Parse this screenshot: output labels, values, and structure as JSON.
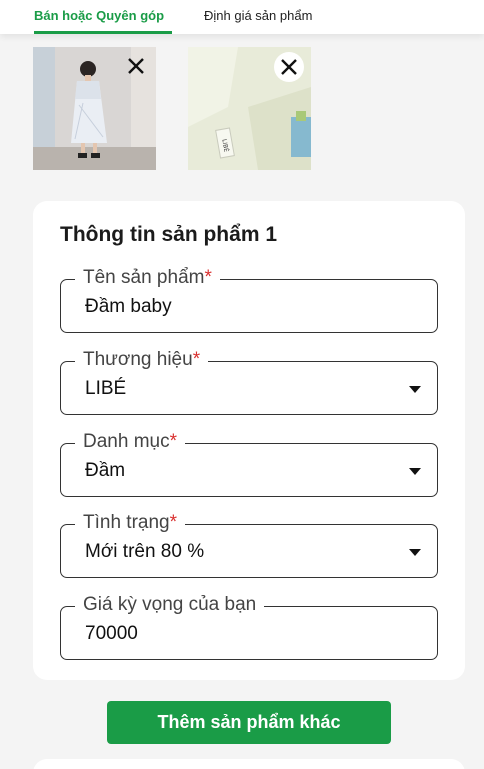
{
  "tabs": [
    {
      "label": "Bán hoặc Quyên góp",
      "active": true
    },
    {
      "label": "Định giá sản phẩm",
      "active": false
    }
  ],
  "photos": [
    {
      "alt": "woman in light dress photo",
      "icon": "close-icon"
    },
    {
      "alt": "garment label close-up photo",
      "icon": "close-icon"
    }
  ],
  "product_card": {
    "title": "Thông tin sản phẩm 1",
    "fields": [
      {
        "label": "Tên sản phẩm",
        "required": "*",
        "value": "Đầm baby",
        "type": "text"
      },
      {
        "label": "Thương hiệu",
        "required": "*",
        "value": "LIBÉ",
        "type": "select"
      },
      {
        "label": "Danh mục",
        "required": "*",
        "value": "Đầm",
        "type": "select"
      },
      {
        "label": "Tình trạng",
        "required": "*",
        "value": "Mới trên 80 %",
        "type": "select"
      },
      {
        "label": "Giá kỳ vọng của bạn",
        "required": "",
        "value": "70000",
        "type": "text"
      }
    ]
  },
  "actions": {
    "add_product_label": "Thêm sản phẩm khác"
  },
  "colors": {
    "accent": "#1a9c47",
    "required": "#d9302f",
    "background": "#f4f4f4"
  }
}
